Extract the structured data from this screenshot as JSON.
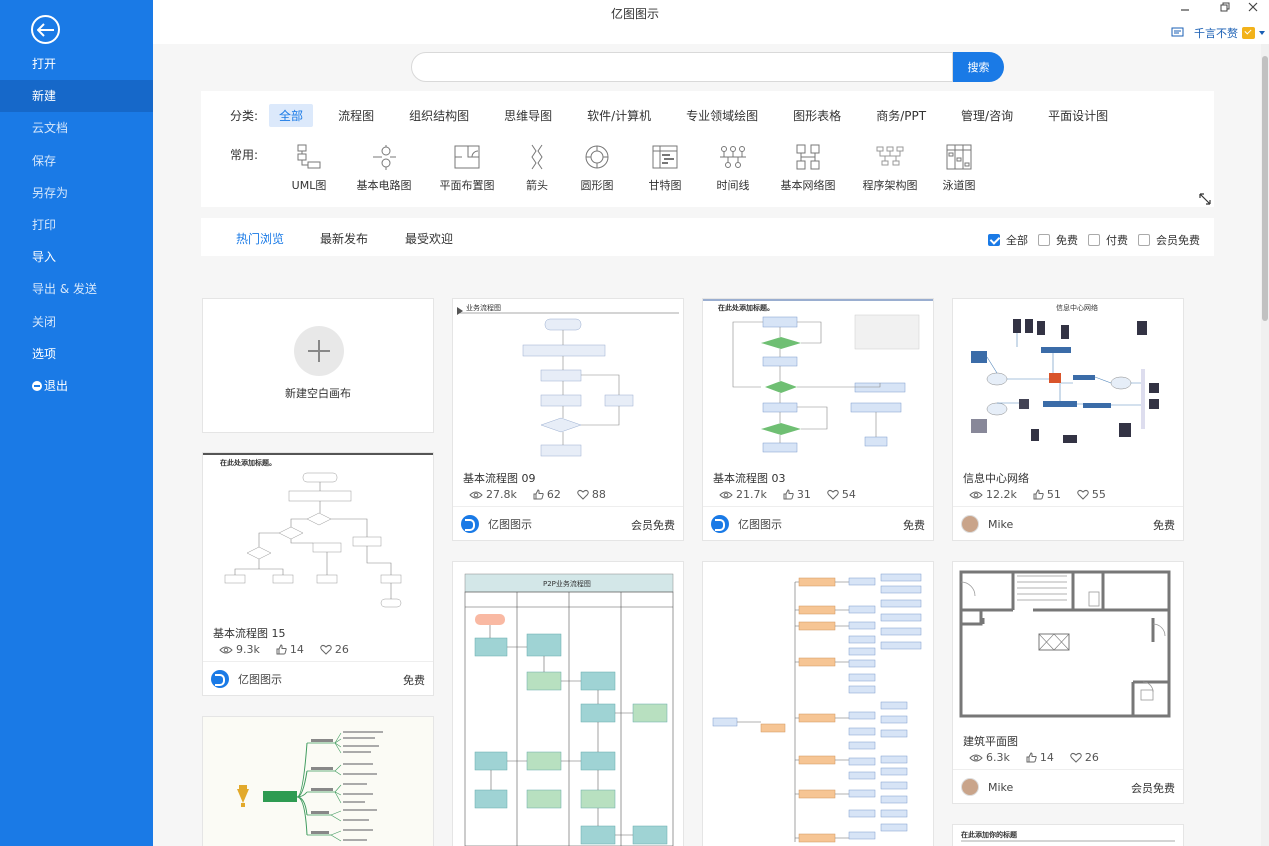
{
  "app_title": "亿图图示",
  "sidebar": {
    "items": [
      {
        "label": "打开"
      },
      {
        "label": "新建"
      },
      {
        "label": "云文档"
      },
      {
        "label": "保存"
      },
      {
        "label": "另存为"
      },
      {
        "label": "打印"
      },
      {
        "label": "导入"
      },
      {
        "label": "导出 & 发送"
      },
      {
        "label": "关闭"
      },
      {
        "label": "选项"
      },
      {
        "label": "退出"
      }
    ]
  },
  "user": {
    "name": "千言不赘"
  },
  "search": {
    "placeholder": "",
    "button_label": "搜索"
  },
  "categories": {
    "label": "分类:",
    "items": [
      "全部",
      "流程图",
      "组织结构图",
      "思维导图",
      "软件/计算机",
      "专业领域绘图",
      "图形表格",
      "商务/PPT",
      "管理/咨询",
      "平面设计图"
    ]
  },
  "common": {
    "label": "常用:",
    "items": [
      "UML图",
      "基本电路图",
      "平面布置图",
      "箭头",
      "圆形图",
      "甘特图",
      "时间线",
      "基本网络图",
      "程序架构图",
      "泳道图"
    ]
  },
  "tabs": [
    "热门浏览",
    "最新发布",
    "最受欢迎"
  ],
  "filters": [
    "全部",
    "免费",
    "付费",
    "会员免费"
  ],
  "new_blank": "新建空白画布",
  "cards": [
    {
      "title": "基本流程图 09",
      "thumb_title": "业务流程图",
      "views": "27.8k",
      "likes": "62",
      "favs": "88",
      "author": "亿图图示",
      "price": "会员免费"
    },
    {
      "title": "基本流程图 03",
      "thumb_title": "在此处添加标题。",
      "views": "21.7k",
      "likes": "31",
      "favs": "54",
      "author": "亿图图示",
      "price": "免费"
    },
    {
      "title": "信息中心网络",
      "thumb_title": "信息中心网络",
      "views": "12.2k",
      "likes": "51",
      "favs": "55",
      "author": "Mike",
      "price": "免费"
    },
    {
      "title": "基本流程图 15",
      "thumb_title": "在此处添加标题。",
      "views": "9.3k",
      "likes": "14",
      "favs": "26",
      "author": "亿图图示",
      "price": "免费"
    },
    {
      "title": "建筑平面图",
      "views": "6.3k",
      "likes": "14",
      "favs": "26",
      "author": "Mike",
      "price": "会员免费"
    }
  ],
  "partial_thumbs": {
    "p2p_title": "P2P业务流程图",
    "bottom_title": "在此添加你的标题"
  }
}
